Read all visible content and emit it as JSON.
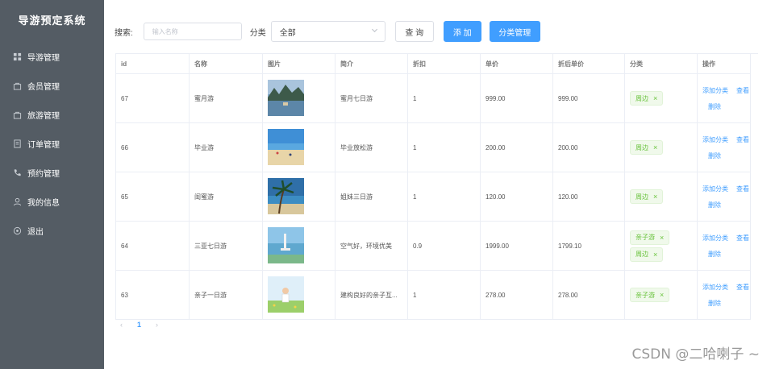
{
  "sidebar": {
    "title": "导游预定系统",
    "items": [
      {
        "label": "导游管理",
        "icon": "grid-icon"
      },
      {
        "label": "会员管理",
        "icon": "bag-icon"
      },
      {
        "label": "旅游管理",
        "icon": "bag-icon"
      },
      {
        "label": "订单管理",
        "icon": "document-icon"
      },
      {
        "label": "预约管理",
        "icon": "phone-icon"
      },
      {
        "label": "我的信息",
        "icon": "user-icon"
      },
      {
        "label": "退出",
        "icon": "logout-icon"
      }
    ]
  },
  "toolbar": {
    "search_label": "搜索:",
    "search_placeholder": "输入名称",
    "category_label": "分类",
    "category_selected": "全部",
    "query_button": "查 询",
    "add_button": "添 加",
    "category_manage_button": "分类管理"
  },
  "table": {
    "headers": [
      "id",
      "名称",
      "图片",
      "简介",
      "折扣",
      "单价",
      "折后单价",
      "分类",
      "操作"
    ],
    "rows": [
      {
        "id": "67",
        "name": "蜜月游",
        "intro": "蜜月七日游",
        "discount": "1",
        "price": "999.00",
        "discount_price": "999.00",
        "tags": [
          "周边"
        ],
        "image": "lake-photo"
      },
      {
        "id": "66",
        "name": "毕业游",
        "intro": "毕业放松游",
        "discount": "1",
        "price": "200.00",
        "discount_price": "200.00",
        "tags": [
          "周边"
        ],
        "image": "beach-photo"
      },
      {
        "id": "65",
        "name": "闺蜜游",
        "intro": "姐妹三日游",
        "discount": "1",
        "price": "120.00",
        "discount_price": "120.00",
        "tags": [
          "周边"
        ],
        "image": "palm-beach-photo"
      },
      {
        "id": "64",
        "name": "三亚七日游",
        "intro": "空气好，环境优美",
        "discount": "0.9",
        "price": "1999.00",
        "discount_price": "1799.10",
        "tags": [
          "亲子游",
          "周边"
        ],
        "image": "sanya-photo"
      },
      {
        "id": "63",
        "name": "亲子一日游",
        "intro": "建构良好的亲子互...",
        "discount": "1",
        "price": "278.00",
        "discount_price": "278.00",
        "tags": [
          "亲子游"
        ],
        "image": "meadow-photo"
      }
    ],
    "ops": {
      "add_category": "添加分类",
      "view": "查看",
      "delete": "删除"
    },
    "tag_close": "×"
  },
  "pagination": {
    "prev": "‹",
    "current": "1",
    "next": "›"
  },
  "watermark": "CSDN @二哈喇子 ~",
  "colors": {
    "sidebar_bg": "#545c64",
    "primary": "#409eff",
    "tag_green": "#67c23a"
  }
}
